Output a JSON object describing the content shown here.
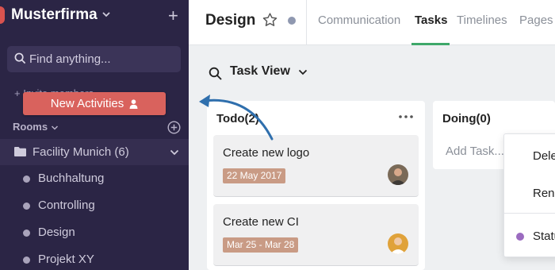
{
  "sidebar": {
    "workspace_name": "Musterfirma",
    "search_placeholder": "Find anything...",
    "invite_text": "+ Invite members",
    "new_activities_label": "New Activities",
    "rooms_label": "Rooms",
    "room_group": {
      "label": "Facility Munich (6)"
    },
    "rooms": [
      {
        "label": "Buchhaltung"
      },
      {
        "label": "Controlling"
      },
      {
        "label": "Design"
      },
      {
        "label": "Projekt XY"
      }
    ]
  },
  "header": {
    "title": "Design",
    "tabs": [
      {
        "label": "Communication",
        "active": false
      },
      {
        "label": "Tasks",
        "active": true
      },
      {
        "label": "Timelines",
        "active": false
      },
      {
        "label": "Pages",
        "active": false
      }
    ]
  },
  "view": {
    "title": "Task View"
  },
  "columns": {
    "todo": {
      "title": "Todo(2)",
      "cards": [
        {
          "title": "Create new logo",
          "date": "22 May 2017"
        },
        {
          "title": "Create new CI",
          "date": "Mar 25 - Mar 28"
        }
      ]
    },
    "doing": {
      "title": "Doing(0)",
      "add_task": "Add Task..."
    }
  },
  "context_menu": {
    "items": [
      {
        "label": "Delete"
      },
      {
        "label": "Rename"
      },
      {
        "label": "Status"
      }
    ]
  },
  "colors": {
    "sidebar_bg": "#2b2545",
    "accent": "#d9625d",
    "active_tab": "#3ea86a",
    "date_badge": "#c99b85",
    "arrow": "#2f6fad"
  }
}
